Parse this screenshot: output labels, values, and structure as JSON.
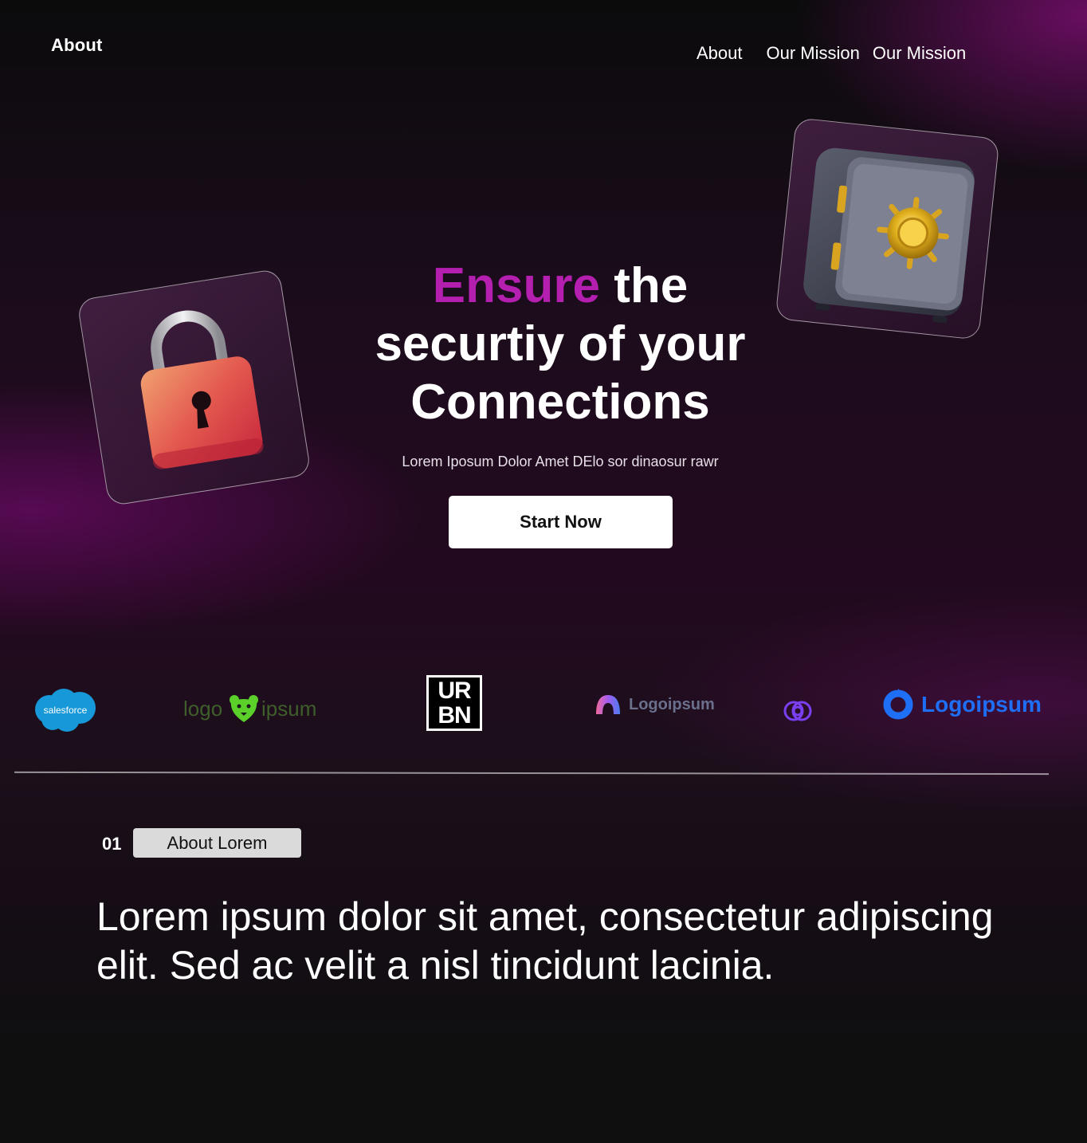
{
  "header": {
    "brand": "About",
    "nav": [
      "About",
      "Our Mission",
      "Our Mission"
    ]
  },
  "hero": {
    "title_accent": "Ensure",
    "title_rest_1": " the",
    "title_line_2": "securtiy of your",
    "title_line_3": "Connections",
    "subtitle": "Lorem Iposum Dolor Amet DElo sor dinaosur rawr",
    "cta_label": "Start Now"
  },
  "logos": [
    {
      "name": "salesforce",
      "text": "salesforce"
    },
    {
      "name": "logo-ipsum-bear",
      "text": "logo ipsum"
    },
    {
      "name": "urbn",
      "text": "URBN"
    },
    {
      "name": "logoipsum-gradient",
      "text": "Logoipsum"
    },
    {
      "name": "logoipsum-swirl",
      "text": ""
    },
    {
      "name": "logoipsum-blue",
      "text": "Logoipsum"
    }
  ],
  "about": {
    "number": "01",
    "label": "About Lorem",
    "paragraph": "Lorem ipsum dolor sit amet, consectetur adipiscing elit. Sed ac velit a nisl tincidunt lacinia."
  },
  "colors": {
    "accent": "#b51fb0",
    "background": "#0f0f10",
    "cta_bg": "#ffffff",
    "pill_bg": "#dadada"
  }
}
